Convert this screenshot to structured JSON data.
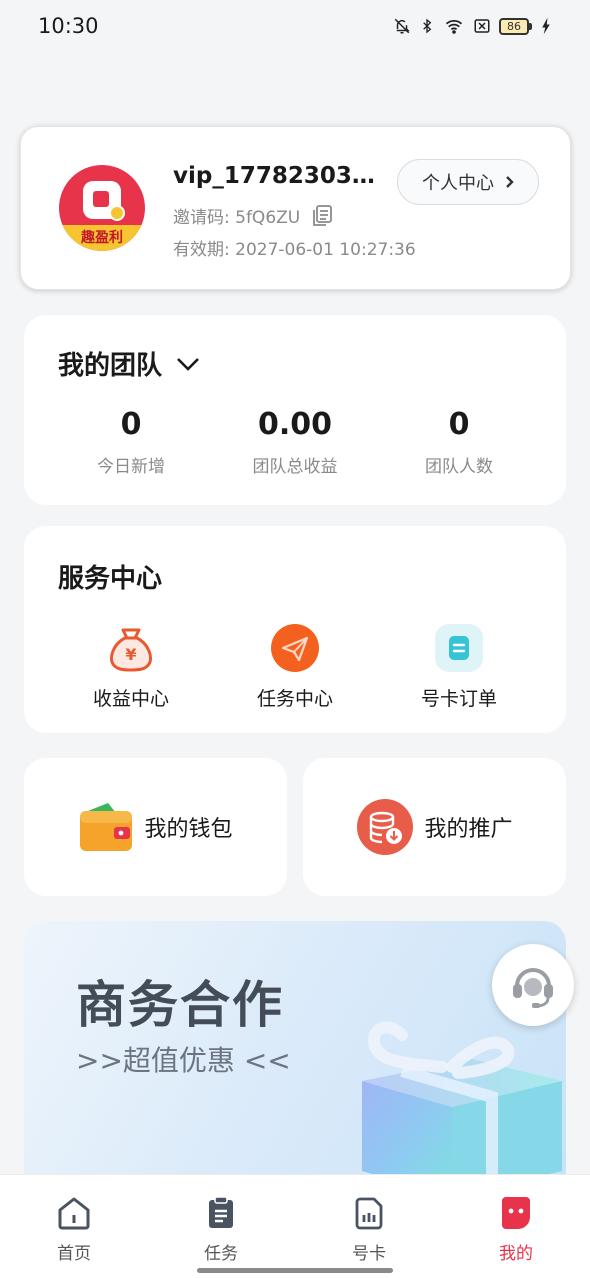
{
  "status_bar": {
    "time": "10:30",
    "battery_level": "86",
    "icons": [
      "bell-off-icon",
      "bluetooth-icon",
      "wifi-icon",
      "sim-off-icon",
      "battery-icon",
      "charging-icon"
    ]
  },
  "profile": {
    "avatar_text": "趣盈利",
    "username": "vip_17782303…",
    "invite_label": "邀请码: 5fQ6ZU",
    "expire_label": "有效期: 2027-06-01 10:27:36",
    "personal_center_label": "个人中心"
  },
  "team": {
    "title": "我的团队",
    "stats": [
      {
        "value": "0",
        "label": "今日新增"
      },
      {
        "value": "0.00",
        "label": "团队总收益"
      },
      {
        "value": "0",
        "label": "团队人数"
      }
    ]
  },
  "service": {
    "title": "服务中心",
    "items": [
      {
        "label": "收益中心",
        "icon": "money-bag-icon"
      },
      {
        "label": "任务中心",
        "icon": "paper-plane-icon"
      },
      {
        "label": "号卡订单",
        "icon": "order-icon"
      }
    ]
  },
  "shortcuts": {
    "wallet_label": "我的钱包",
    "promo_label": "我的推广"
  },
  "banner": {
    "title": "商务合作",
    "subtitle": ">>超值优惠 <<"
  },
  "bottom_nav": {
    "items": [
      {
        "label": "首页",
        "icon": "home-icon"
      },
      {
        "label": "任务",
        "icon": "clipboard-icon"
      },
      {
        "label": "号卡",
        "icon": "sim-card-icon"
      },
      {
        "label": "我的",
        "icon": "profile-icon"
      }
    ],
    "active": "我的"
  },
  "colors": {
    "accent": "#e8344a",
    "background": "#f4f5f7",
    "muted_text": "#8a8a8a"
  }
}
